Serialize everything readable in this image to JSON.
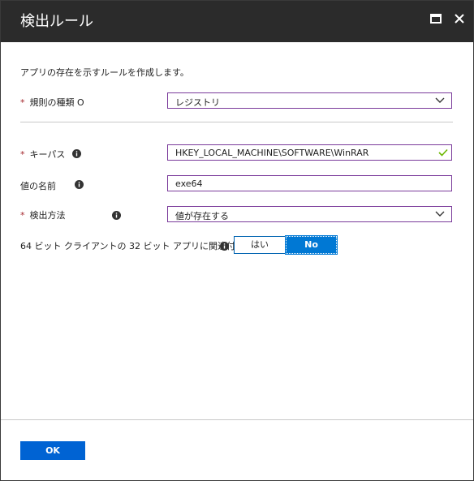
{
  "dialog": {
    "title": "検出ルール",
    "description": "アプリの存在を示すルールを作成します。",
    "ok_label": "OK"
  },
  "form": {
    "rule_type": {
      "required_mark": "*",
      "label": "規則の種類",
      "label_suffix": "O",
      "value": "レジストリ"
    },
    "key_path": {
      "required_mark": "*",
      "label": "キーパス",
      "value": "HKEY_LOCAL_MACHINE\\SOFTWARE\\WinRAR"
    },
    "value_name": {
      "label": "値の名前",
      "value": "exe64"
    },
    "detection_method": {
      "required_mark": "*",
      "label": "検出方法",
      "value": "値が存在する"
    },
    "associated_32bit": {
      "label": "64 ビット クライアントの 32 ビット アプリに関連付けられている",
      "yes_label": "はい",
      "no_label": "No",
      "selected": "No"
    }
  },
  "colors": {
    "titlebar": "#2b2b2b",
    "accent": "#0078d4",
    "field_border": "#7a3a9a",
    "required": "#a4262c",
    "valid_check": "#6bb700"
  },
  "icons": [
    "maximize-icon",
    "close-icon",
    "info-icon",
    "chevron-down-icon",
    "checkmark-icon"
  ]
}
